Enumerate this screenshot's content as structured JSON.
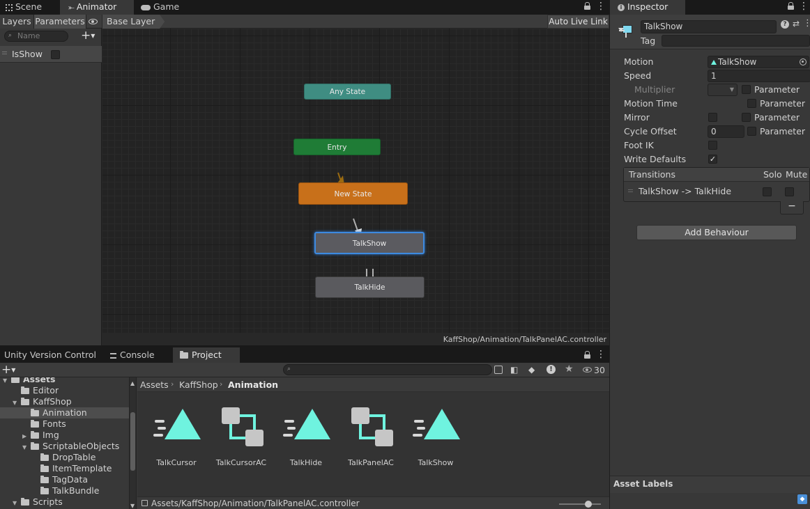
{
  "top_tabs": {
    "scene": "Scene",
    "animator": "Animator",
    "game": "Game",
    "inspector": "Inspector"
  },
  "animator": {
    "layers_tab": "Layers",
    "parameters_tab": "Parameters",
    "search_placeholder": "Name",
    "parameters": [
      {
        "name": "IsShow",
        "type": "bool",
        "checked": false
      }
    ],
    "breadcrumb": "Base Layer",
    "auto_live_link": "Auto Live Link",
    "footer_path": "KaffShop/Animation/TalkPanelAC.controller",
    "nodes": {
      "any_state": "Any State",
      "entry": "Entry",
      "new_state": "New State",
      "talk_show": "TalkShow",
      "talk_hide": "TalkHide"
    }
  },
  "inspector": {
    "object_name": "TalkShow",
    "tag_label": "Tag",
    "motion_label": "Motion",
    "motion_value": "TalkShow",
    "speed_label": "Speed",
    "speed_value": "1",
    "multiplier_label": "Multiplier",
    "parameter_label": "Parameter",
    "motion_time_label": "Motion Time",
    "mirror_label": "Mirror",
    "cycle_offset_label": "Cycle Offset",
    "cycle_offset_value": "0",
    "foot_ik_label": "Foot IK",
    "write_defaults_label": "Write Defaults",
    "write_defaults_checked": true,
    "transitions_header": "Transitions",
    "solo_header": "Solo",
    "mute_header": "Mute",
    "transitions": [
      {
        "label": "TalkShow -> TalkHide",
        "solo": false,
        "mute": false
      }
    ],
    "remove_button": "−",
    "add_behaviour": "Add Behaviour",
    "asset_labels": "Asset Labels"
  },
  "bottom_tabs": {
    "uvc": "Unity Version Control",
    "console": "Console",
    "project": "Project"
  },
  "project": {
    "search_value": "",
    "visibility_count": "30",
    "breadcrumb": [
      "Assets",
      "KaffShop",
      "Animation"
    ],
    "tree": [
      {
        "label": "Assets",
        "depth": 0,
        "expanded": true
      },
      {
        "label": "Editor",
        "depth": 1
      },
      {
        "label": "KaffShop",
        "depth": 1,
        "expanded": true
      },
      {
        "label": "Animation",
        "depth": 2,
        "selected": true
      },
      {
        "label": "Fonts",
        "depth": 2
      },
      {
        "label": "Img",
        "depth": 2,
        "collapsed": true
      },
      {
        "label": "ScriptableObjects",
        "depth": 2,
        "expanded": true
      },
      {
        "label": "DropTable",
        "depth": 3
      },
      {
        "label": "ItemTemplate",
        "depth": 3
      },
      {
        "label": "TagData",
        "depth": 3
      },
      {
        "label": "TalkBundle",
        "depth": 3
      },
      {
        "label": "Scripts",
        "depth": 1,
        "expanded": true
      }
    ],
    "assets": [
      {
        "name": "TalkCursor",
        "kind": "animation-clip"
      },
      {
        "name": "TalkCursorAC",
        "kind": "animator-controller"
      },
      {
        "name": "TalkHide",
        "kind": "animation-clip"
      },
      {
        "name": "TalkPanelAC",
        "kind": "animator-controller"
      },
      {
        "name": "TalkShow",
        "kind": "animation-clip"
      }
    ],
    "status_path": "Assets/KaffShop/Animation/TalkPanelAC.controller"
  },
  "colors": {
    "accent": "#6ff3df",
    "selection": "#4a90d9",
    "entry": "#1e7a35",
    "any_state": "#3e8c80",
    "new_state": "#c8701a",
    "state": "#5b5b5f"
  }
}
